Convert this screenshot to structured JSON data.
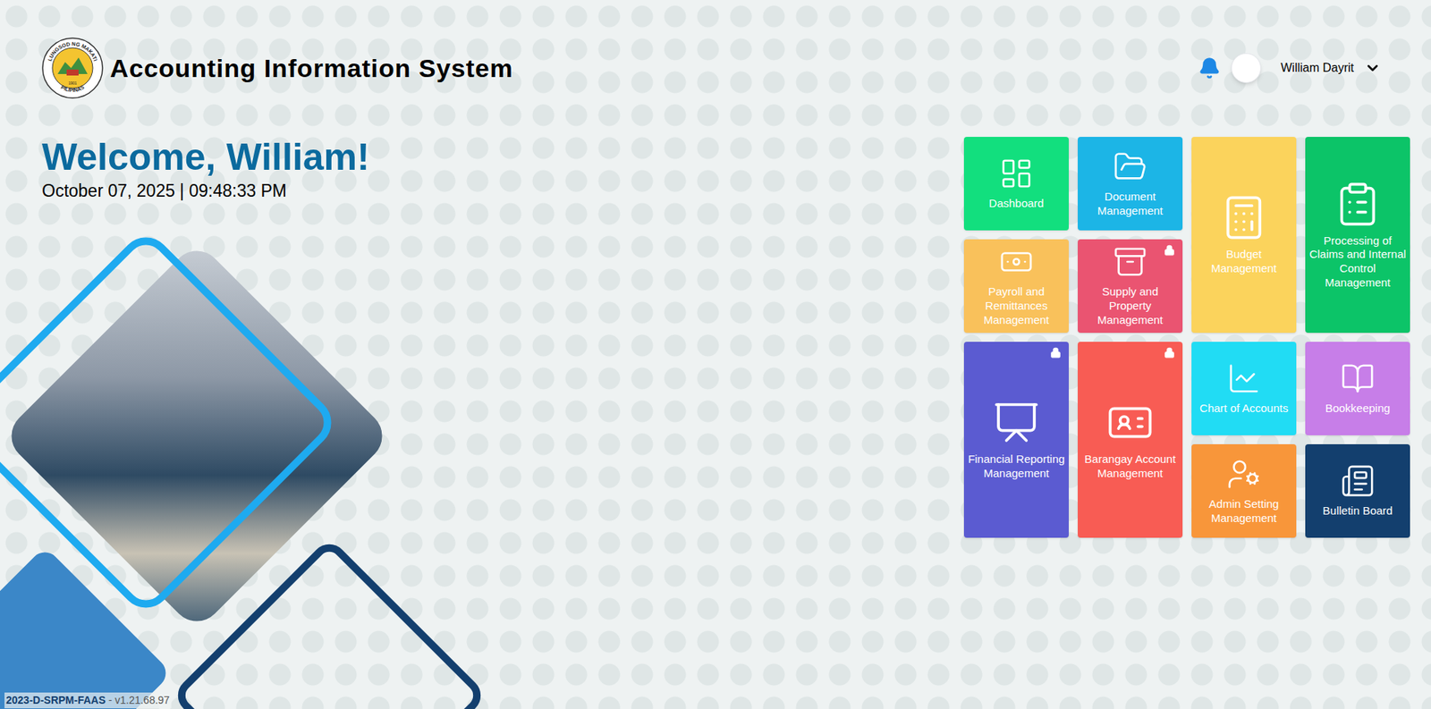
{
  "header": {
    "title": "Accounting Information System",
    "seal": {
      "top": "LUNGSOD NG MAKATI",
      "bottom": "PILIPINAS",
      "year": "1901"
    },
    "user": {
      "name": "William Dayrit"
    }
  },
  "welcome": {
    "greeting": "Welcome, William!",
    "datetime": "October 07, 2025 | 09:48:33 PM"
  },
  "modules": [
    {
      "label": "Dashboard",
      "locked": false,
      "color": "#12df7e"
    },
    {
      "label": "Document Management",
      "locked": false,
      "color": "#1cb5e6"
    },
    {
      "label": "Budget Management",
      "locked": false,
      "color": "#fbd35c"
    },
    {
      "label": "Processing of Claims and Internal Control Management",
      "locked": false,
      "color": "#0cc468"
    },
    {
      "label": "Payroll and Remittances Management",
      "locked": false,
      "color": "#f9c15b"
    },
    {
      "label": "Supply and Property Management",
      "locked": true,
      "color": "#ea5471"
    },
    {
      "label": "Financial Reporting Management",
      "locked": true,
      "color": "#5b5bd1"
    },
    {
      "label": "Barangay Account Management",
      "locked": true,
      "color": "#f85c54"
    },
    {
      "label": "Chart of Accounts",
      "locked": false,
      "color": "#21dcf4"
    },
    {
      "label": "Bookkeeping",
      "locked": false,
      "color": "#c77ee8"
    },
    {
      "label": "Admin Setting Management",
      "locked": false,
      "color": "#f8963a"
    },
    {
      "label": "Bulletin Board",
      "locked": false,
      "color": "#133f6e"
    }
  ],
  "footer": {
    "code": "2023-D-SRPM-FAAS",
    "version": " - v1.21.68.97"
  }
}
